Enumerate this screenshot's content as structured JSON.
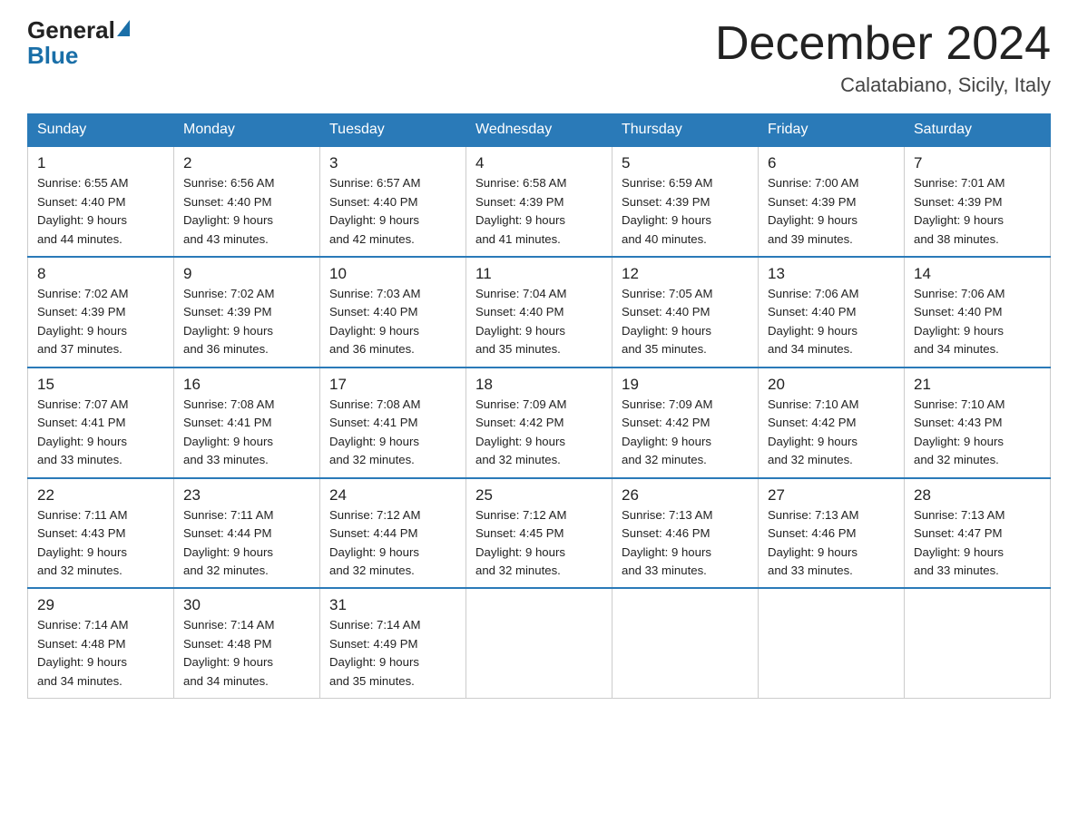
{
  "header": {
    "logo_general": "General",
    "logo_blue": "Blue",
    "month_title": "December 2024",
    "location": "Calatabiano, Sicily, Italy"
  },
  "days_of_week": [
    "Sunday",
    "Monday",
    "Tuesday",
    "Wednesday",
    "Thursday",
    "Friday",
    "Saturday"
  ],
  "weeks": [
    [
      {
        "day": "1",
        "sunrise": "6:55 AM",
        "sunset": "4:40 PM",
        "daylight": "9 hours and 44 minutes."
      },
      {
        "day": "2",
        "sunrise": "6:56 AM",
        "sunset": "4:40 PM",
        "daylight": "9 hours and 43 minutes."
      },
      {
        "day": "3",
        "sunrise": "6:57 AM",
        "sunset": "4:40 PM",
        "daylight": "9 hours and 42 minutes."
      },
      {
        "day": "4",
        "sunrise": "6:58 AM",
        "sunset": "4:39 PM",
        "daylight": "9 hours and 41 minutes."
      },
      {
        "day": "5",
        "sunrise": "6:59 AM",
        "sunset": "4:39 PM",
        "daylight": "9 hours and 40 minutes."
      },
      {
        "day": "6",
        "sunrise": "7:00 AM",
        "sunset": "4:39 PM",
        "daylight": "9 hours and 39 minutes."
      },
      {
        "day": "7",
        "sunrise": "7:01 AM",
        "sunset": "4:39 PM",
        "daylight": "9 hours and 38 minutes."
      }
    ],
    [
      {
        "day": "8",
        "sunrise": "7:02 AM",
        "sunset": "4:39 PM",
        "daylight": "9 hours and 37 minutes."
      },
      {
        "day": "9",
        "sunrise": "7:02 AM",
        "sunset": "4:39 PM",
        "daylight": "9 hours and 36 minutes."
      },
      {
        "day": "10",
        "sunrise": "7:03 AM",
        "sunset": "4:40 PM",
        "daylight": "9 hours and 36 minutes."
      },
      {
        "day": "11",
        "sunrise": "7:04 AM",
        "sunset": "4:40 PM",
        "daylight": "9 hours and 35 minutes."
      },
      {
        "day": "12",
        "sunrise": "7:05 AM",
        "sunset": "4:40 PM",
        "daylight": "9 hours and 35 minutes."
      },
      {
        "day": "13",
        "sunrise": "7:06 AM",
        "sunset": "4:40 PM",
        "daylight": "9 hours and 34 minutes."
      },
      {
        "day": "14",
        "sunrise": "7:06 AM",
        "sunset": "4:40 PM",
        "daylight": "9 hours and 34 minutes."
      }
    ],
    [
      {
        "day": "15",
        "sunrise": "7:07 AM",
        "sunset": "4:41 PM",
        "daylight": "9 hours and 33 minutes."
      },
      {
        "day": "16",
        "sunrise": "7:08 AM",
        "sunset": "4:41 PM",
        "daylight": "9 hours and 33 minutes."
      },
      {
        "day": "17",
        "sunrise": "7:08 AM",
        "sunset": "4:41 PM",
        "daylight": "9 hours and 32 minutes."
      },
      {
        "day": "18",
        "sunrise": "7:09 AM",
        "sunset": "4:42 PM",
        "daylight": "9 hours and 32 minutes."
      },
      {
        "day": "19",
        "sunrise": "7:09 AM",
        "sunset": "4:42 PM",
        "daylight": "9 hours and 32 minutes."
      },
      {
        "day": "20",
        "sunrise": "7:10 AM",
        "sunset": "4:42 PM",
        "daylight": "9 hours and 32 minutes."
      },
      {
        "day": "21",
        "sunrise": "7:10 AM",
        "sunset": "4:43 PM",
        "daylight": "9 hours and 32 minutes."
      }
    ],
    [
      {
        "day": "22",
        "sunrise": "7:11 AM",
        "sunset": "4:43 PM",
        "daylight": "9 hours and 32 minutes."
      },
      {
        "day": "23",
        "sunrise": "7:11 AM",
        "sunset": "4:44 PM",
        "daylight": "9 hours and 32 minutes."
      },
      {
        "day": "24",
        "sunrise": "7:12 AM",
        "sunset": "4:44 PM",
        "daylight": "9 hours and 32 minutes."
      },
      {
        "day": "25",
        "sunrise": "7:12 AM",
        "sunset": "4:45 PM",
        "daylight": "9 hours and 32 minutes."
      },
      {
        "day": "26",
        "sunrise": "7:13 AM",
        "sunset": "4:46 PM",
        "daylight": "9 hours and 33 minutes."
      },
      {
        "day": "27",
        "sunrise": "7:13 AM",
        "sunset": "4:46 PM",
        "daylight": "9 hours and 33 minutes."
      },
      {
        "day": "28",
        "sunrise": "7:13 AM",
        "sunset": "4:47 PM",
        "daylight": "9 hours and 33 minutes."
      }
    ],
    [
      {
        "day": "29",
        "sunrise": "7:14 AM",
        "sunset": "4:48 PM",
        "daylight": "9 hours and 34 minutes."
      },
      {
        "day": "30",
        "sunrise": "7:14 AM",
        "sunset": "4:48 PM",
        "daylight": "9 hours and 34 minutes."
      },
      {
        "day": "31",
        "sunrise": "7:14 AM",
        "sunset": "4:49 PM",
        "daylight": "9 hours and 35 minutes."
      },
      null,
      null,
      null,
      null
    ]
  ],
  "labels": {
    "sunrise": "Sunrise:",
    "sunset": "Sunset:",
    "daylight": "Daylight:"
  }
}
